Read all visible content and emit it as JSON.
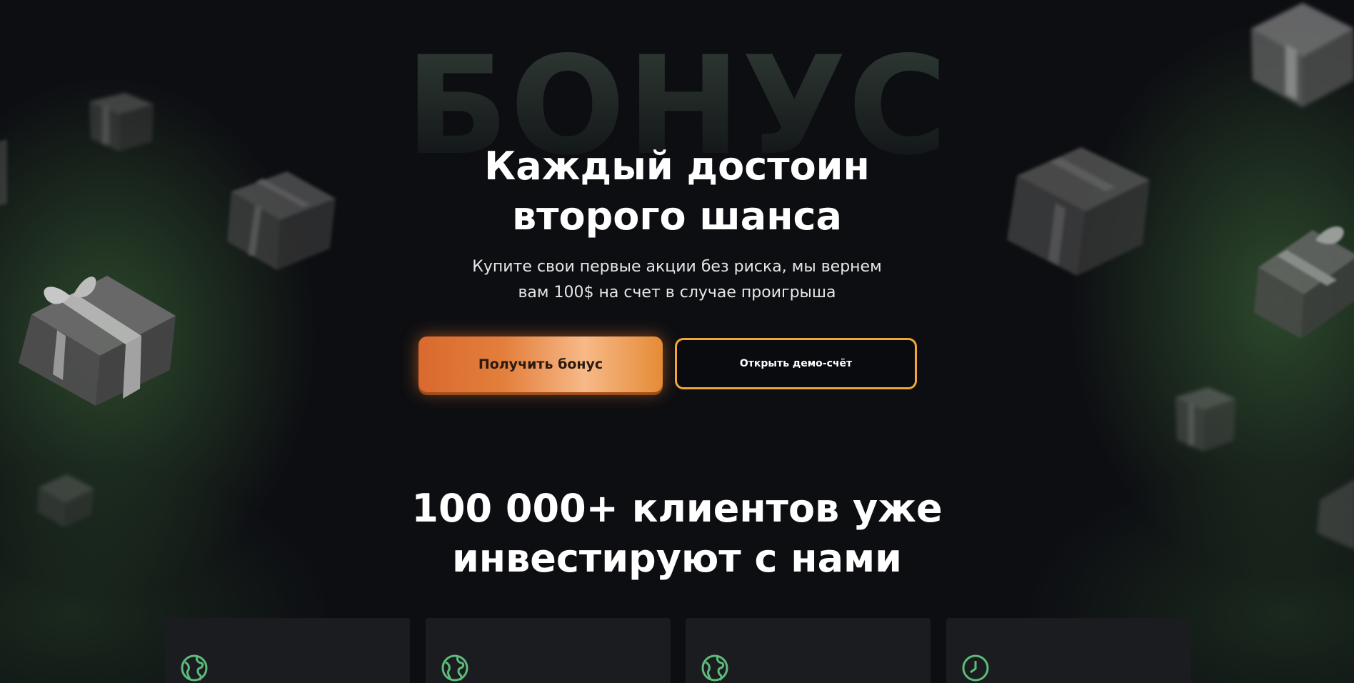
{
  "hero": {
    "background_word": "БОНУС",
    "title_line1": "Каждый достоин",
    "title_line2": "второго шанса",
    "subtitle_line1": "Купите свои первые акции без риска, мы вернем",
    "subtitle_line2": "вам 100$ на счет в случае проигрыша",
    "primary_button": "Получить бонус",
    "secondary_button": "Открыть демо-счёт"
  },
  "stats": {
    "title_line1": "100 000+ клиентов уже",
    "title_line2": "инвестируют с нами",
    "cards": [
      {
        "icon": "globe-icon"
      },
      {
        "icon": "globe-icon"
      },
      {
        "icon": "globe-icon"
      },
      {
        "icon": "clock-icon"
      }
    ]
  },
  "colors": {
    "background": "#0d0e12",
    "accent_orange": "#e37f3c",
    "accent_outline": "#f0a63a",
    "icon_green": "#5dbb7a",
    "card_bg": "#1b1c1f"
  }
}
